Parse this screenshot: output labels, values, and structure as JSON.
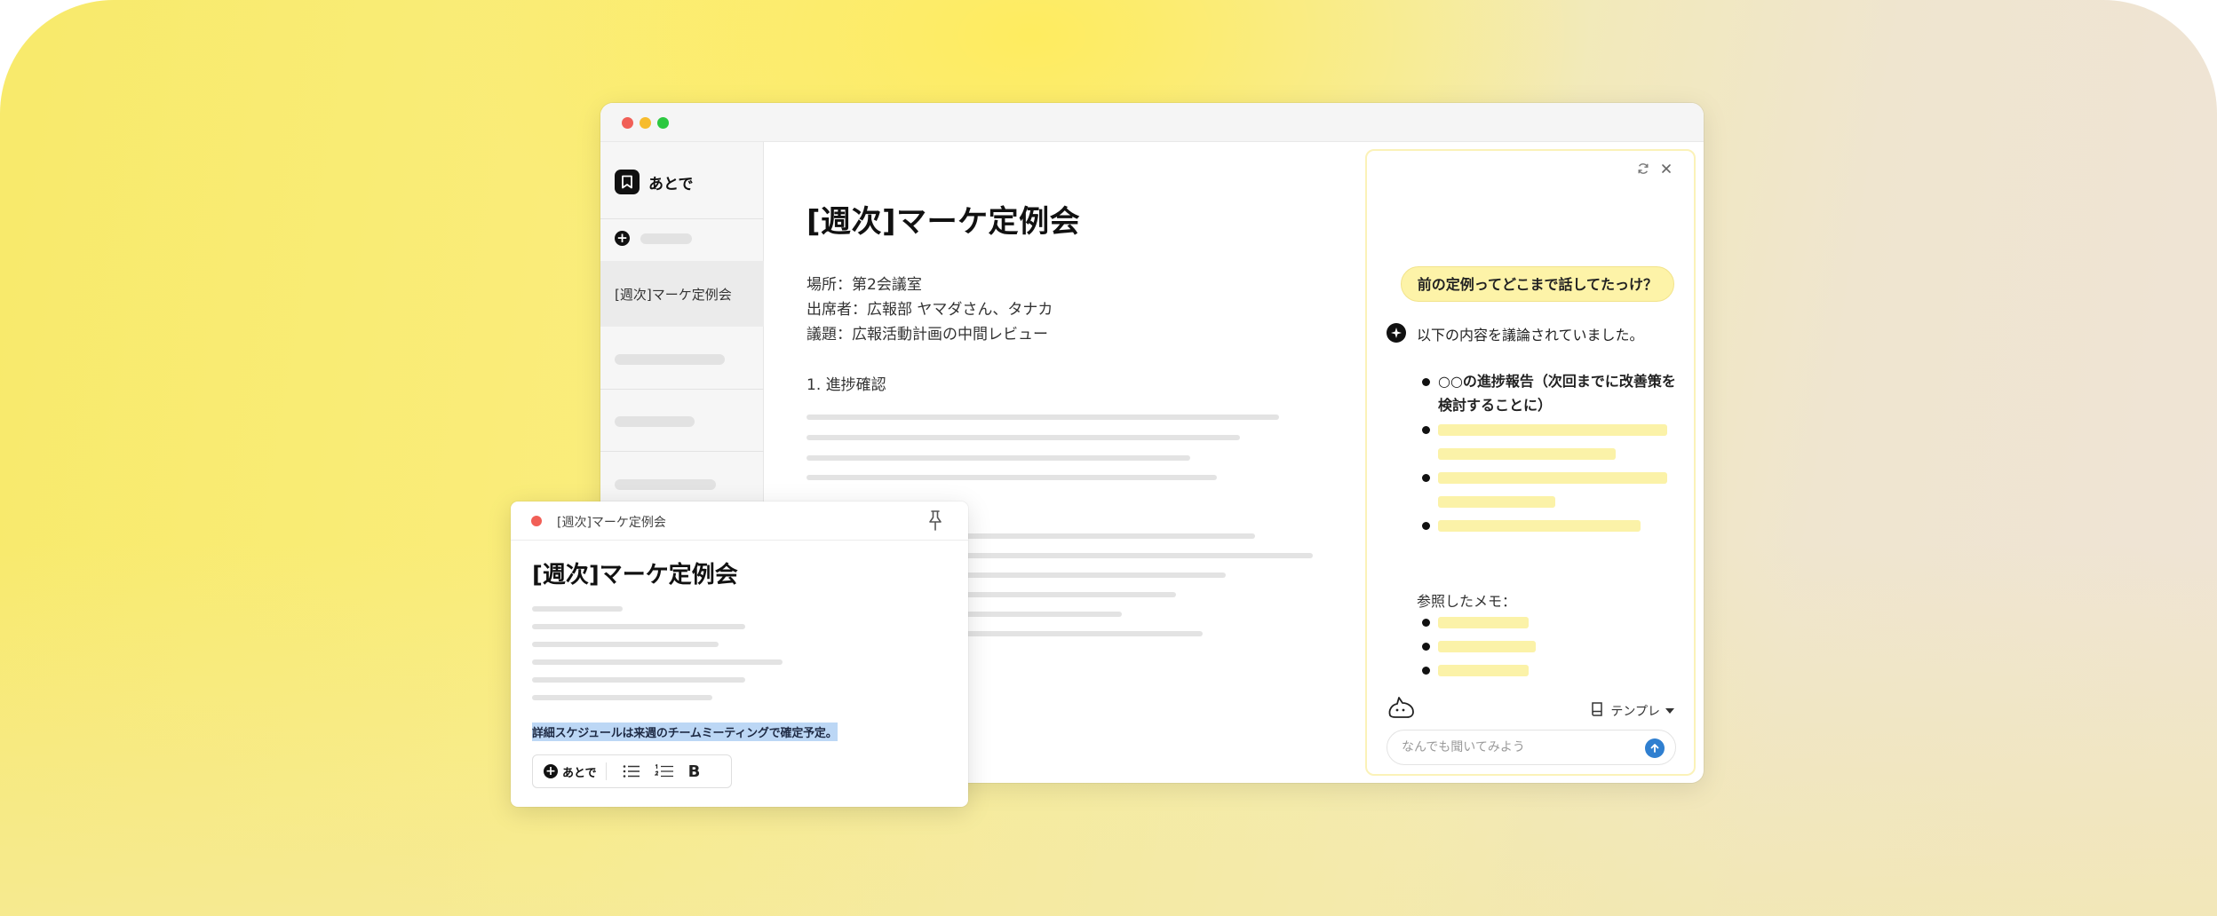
{
  "app": {
    "name": "あとで"
  },
  "sidebar": {
    "active_item": "[週次]マーケ定例会"
  },
  "document": {
    "title": "[週次]マーケ定例会",
    "meta": [
      "場所：第2会議室",
      "出席者：広報部 ヤマダさん、タナカ",
      "議題：広報活動計画の中間レビュー"
    ],
    "section_heading": "1. 進捗確認"
  },
  "chat": {
    "user_message": "前の定例ってどこまで話してたっけ？",
    "ai_intro": "以下の内容を議論されていました。",
    "ai_first_bullet": "○○の進捗報告（次回までに改善策を検討することに）",
    "references_label": "参照したメモ：",
    "template_label": "テンプレ",
    "input_placeholder": "なんでも聞いてみよう",
    "highlight_color": "#fbf2a8",
    "send_color": "#2f7fd0"
  },
  "note": {
    "header_title": "[週次]マーケ定例会",
    "title": "[週次]マーケ定例会",
    "selected_text": "詳細スケジュールは来週のチームミーティングで確定予定。",
    "toolbar_atode_label": "あとで"
  }
}
